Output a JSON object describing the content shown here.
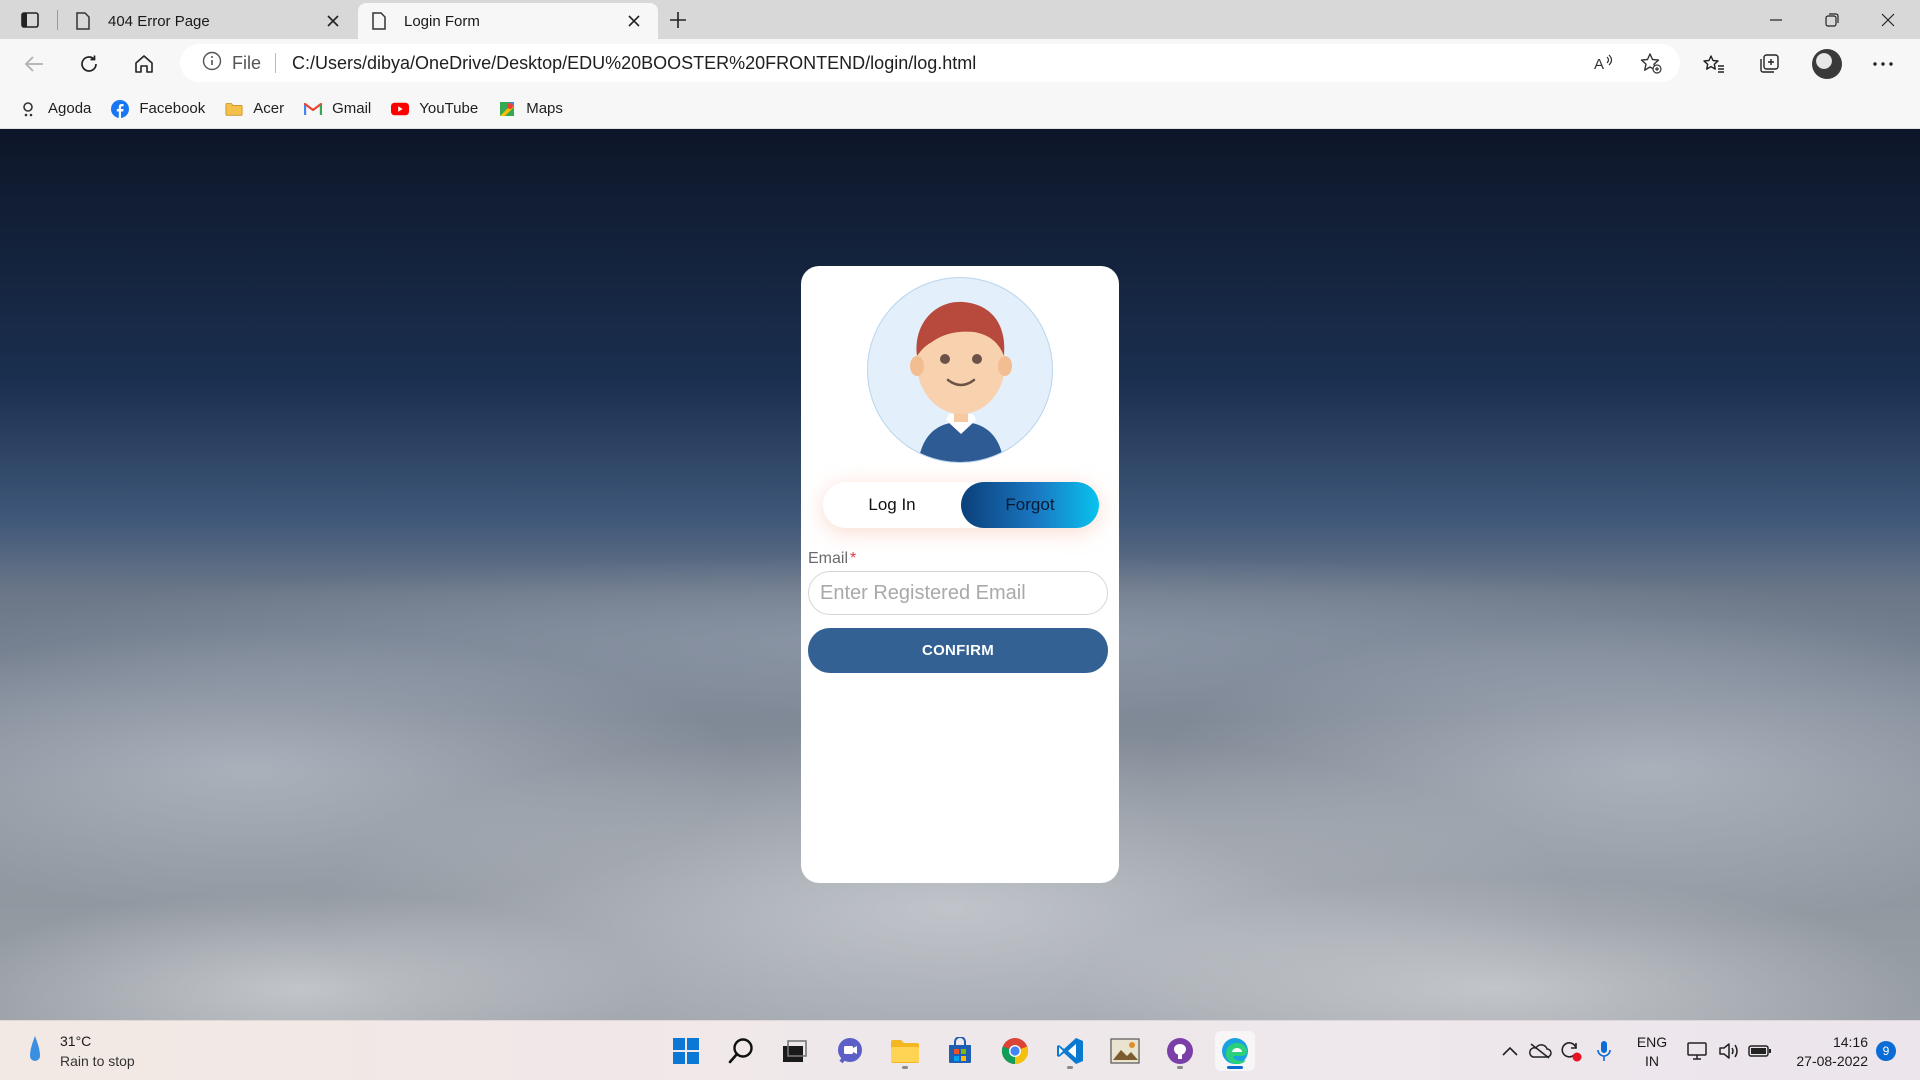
{
  "browser": {
    "tabs": [
      {
        "title": "404 Error Page",
        "active": false
      },
      {
        "title": "Login Form",
        "active": true
      }
    ],
    "url_scheme_label": "File",
    "url": "C:/Users/dibya/OneDrive/Desktop/EDU%20BOOSTER%20FRONTEND/login/log.html",
    "favorites": [
      "Agoda",
      "Facebook",
      "Acer",
      "Gmail",
      "YouTube",
      "Maps"
    ]
  },
  "form": {
    "toggle_login": "Log In",
    "toggle_forgot": "Forgot",
    "active_toggle": "Forgot",
    "email_label": "Email",
    "required_mark": "*",
    "email_placeholder": "Enter Registered Email",
    "email_value": "",
    "confirm_label": "CONFIRM"
  },
  "taskbar": {
    "temperature": "31°C",
    "weather_condition": "Rain to stop",
    "apps": [
      "start-icon",
      "search-icon",
      "task-view-icon",
      "chat-icon",
      "file-explorer-icon",
      "store-icon",
      "chrome-icon",
      "vscode-icon",
      "image-app-icon",
      "github-icon",
      "edge-icon"
    ],
    "language_line1": "ENG",
    "language_line2": "IN",
    "time": "14:16",
    "date": "27-08-2022",
    "notification_count": "9"
  },
  "colors": {
    "confirm_button": "#346193",
    "forgot_gradient_start": "#0b3f7a",
    "forgot_gradient_end": "#08c3ee",
    "accent": "#0a6cd4"
  }
}
